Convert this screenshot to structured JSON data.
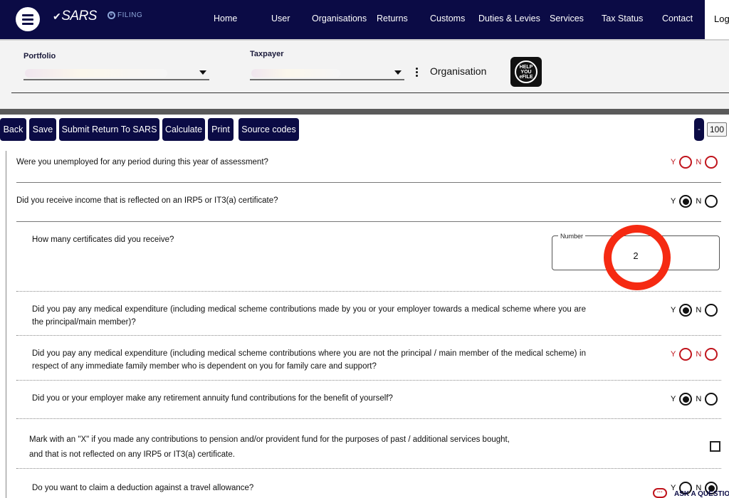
{
  "header": {
    "brand": "SARS",
    "sub_brand": "FILING",
    "nav": [
      "Home",
      "User",
      "Organisations",
      "Returns",
      "Customs",
      "Duties & Levies",
      "Services",
      "Tax Status",
      "Contact",
      "Log"
    ]
  },
  "selection": {
    "portfolio_label": "Portfolio",
    "taxpayer_label": "Taxpayer",
    "organisation_label": "Organisation",
    "help_badge": [
      "HELP",
      "YOU",
      "eFILE"
    ]
  },
  "toolbar": {
    "buttons": [
      "Back",
      "Save",
      "Submit Return To SARS",
      "Calculate",
      "Print",
      "Source codes"
    ],
    "zoom_minus": "-",
    "zoom_value": "100"
  },
  "form": {
    "yes_label": "Y",
    "no_label": "N",
    "questions": [
      {
        "text": "Were you unemployed for any period during this year of assessment?",
        "answer": null,
        "required_unanswered": true
      },
      {
        "text": "Did you receive income that is reflected on an IRP5 or IT3(a) certificate?",
        "answer": "Y",
        "required_unanswered": false
      },
      {
        "text": "How many certificates did you receive?",
        "field_label": "Number",
        "value": "2"
      },
      {
        "text": "Did you pay any medical expenditure (including medical scheme contributions made by you or your employer towards a medical scheme where you are the principal/main member)?",
        "answer": "Y",
        "required_unanswered": false
      },
      {
        "text": "Did you pay any medical expenditure (including medical scheme contributions where you are not the principal / main member of the medical scheme) in respect of any immediate family member who is dependent on you for family care and support?",
        "answer": null,
        "required_unanswered": true
      },
      {
        "text": "Did you or your employer make any retirement annuity fund contributions for the benefit of yourself?",
        "answer": "Y",
        "required_unanswered": false
      },
      {
        "text": "Mark with an \"X\" if you made any contributions to pension and/or provident fund for the purposes of past / additional services bought, and that is not reflected on any IRP5 or IT3(a) certificate.",
        "checked": false
      },
      {
        "text": "Do you want to claim a deduction against a travel allowance?",
        "answer": "N",
        "required_unanswered": false
      }
    ]
  },
  "ask_question": {
    "label": "ASK A QUESTION",
    "icon": "chat-bubble-icon"
  },
  "colors": {
    "nav_bg": "#0b0b45",
    "error": "#c0141c",
    "annotation": "#f52a12"
  }
}
